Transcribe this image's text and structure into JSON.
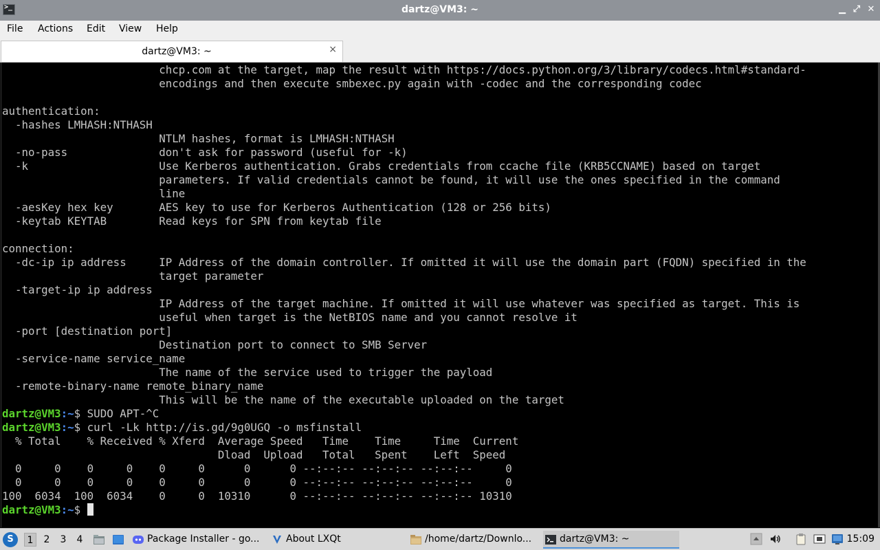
{
  "window": {
    "title": "dartz@VM3: ~",
    "minimize_glyph": "▁",
    "maximize_glyph": "⤢",
    "close_glyph": "✕"
  },
  "menubar": {
    "items": [
      "File",
      "Actions",
      "Edit",
      "View",
      "Help"
    ]
  },
  "tabs": [
    {
      "label": "dartz@VM3: ~",
      "close_glyph": "×"
    }
  ],
  "terminal": {
    "prompt_user": "dartz@VM3",
    "prompt_path": ":~",
    "prompt_symbol": "$ ",
    "lines": [
      "                        chcp.com at the target, map the result with https://docs.python.org/3/library/codecs.html#standard-",
      "                        encodings and then execute smbexec.py again with -codec and the corresponding codec",
      "",
      "authentication:",
      "  -hashes LMHASH:NTHASH",
      "                        NTLM hashes, format is LMHASH:NTHASH",
      "  -no-pass              don't ask for password (useful for -k)",
      "  -k                    Use Kerberos authentication. Grabs credentials from ccache file (KRB5CCNAME) based on target",
      "                        parameters. If valid credentials cannot be found, it will use the ones specified in the command",
      "                        line",
      "  -aesKey hex key       AES key to use for Kerberos Authentication (128 or 256 bits)",
      "  -keytab KEYTAB        Read keys for SPN from keytab file",
      "",
      "connection:",
      "  -dc-ip ip address     IP Address of the domain controller. If omitted it will use the domain part (FQDN) specified in the",
      "                        target parameter",
      "  -target-ip ip address",
      "                        IP Address of the target machine. If omitted it will use whatever was specified as target. This is",
      "                        useful when target is the NetBIOS name and you cannot resolve it",
      "  -port [destination port]",
      "                        Destination port to connect to SMB Server",
      "  -service-name service_name",
      "                        The name of the service used to trigger the payload",
      "  -remote-binary-name remote_binary_name",
      "                        This will be the name of the executable uploaded on the target"
    ],
    "command1": "SUDO APT-^C",
    "command2": "curl -Lk http://is.gd/9g0UGQ -o msfinstall",
    "output": [
      "  % Total    % Received % Xferd  Average Speed   Time    Time     Time  Current",
      "                                 Dload  Upload   Total   Spent    Left  Speed",
      "  0     0    0     0    0     0      0      0 --:--:-- --:--:-- --:--:--     0",
      "  0     0    0     0    0     0      0      0 --:--:-- --:--:-- --:--:--     0",
      "100  6034  100  6034    0     0  10310      0 --:--:-- --:--:-- --:--:-- 10310"
    ]
  },
  "taskbar": {
    "desktops": [
      "1",
      "2",
      "3",
      "4"
    ],
    "tasks": [
      {
        "label": "Package Installer - go...",
        "icon": "discord-icon"
      },
      {
        "label": "About LXQt",
        "icon": "lxqt-icon"
      },
      {
        "label": "/home/dartz/Downlo...",
        "icon": "folder-icon"
      },
      {
        "label": "dartz@VM3: ~",
        "icon": "terminal-icon"
      }
    ],
    "clock": "15:09"
  }
}
